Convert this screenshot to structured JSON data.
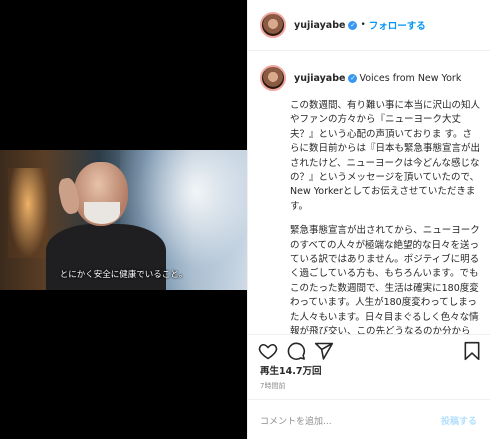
{
  "post": {
    "username": "yujiayabe",
    "follow_label": "フォローする",
    "separator": "•",
    "location": "Voices from New York",
    "caption": [
      "この数週間、有り難い事に本当に沢山の知人やファンの方々から『ニューヨーク大丈夫？』という心配の声頂いておりま す。さらに数日前からは『日本も緊急事態宣言が出されたけど、ニューヨークは今どんな感じなの？』というメッセージを頂いていたので、New Yorkerとしてお伝えさせていただきます。",
      "緊急事態宣言が出されてから、ニューヨークのすべての人々が極端な絶望的な日々を送っている訳ではありません。ポジティブに明るく過ごしている方も、もちろんいます。でもこのたった数週間で、生活は確実に180度変わっています。人生が180度変わってしまった人々もいます。日々目まぐるしく色々な情報が飛び交い、この先どうなるのか分から"
    ],
    "views": "再生14.7万回",
    "time_ago": "7時間前",
    "comment_placeholder": "コメントを追加...",
    "post_label": "投稿する"
  },
  "video": {
    "subtitle": "とにかく安全に健康でいること。"
  },
  "icons": {
    "verified": "verified-badge-icon",
    "like": "heart-icon",
    "comment": "comment-icon",
    "share": "share-icon",
    "save": "bookmark-icon"
  },
  "colors": {
    "follow": "#0095f6",
    "verified": "#3897f0",
    "post_disabled": "#b2dffc"
  }
}
